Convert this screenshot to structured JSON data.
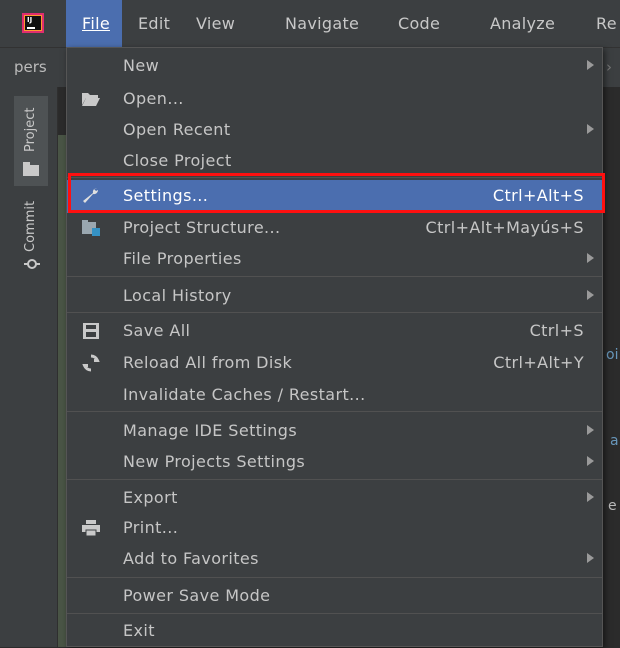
{
  "menubar": {
    "items": [
      {
        "label": "File"
      },
      {
        "label": "Edit"
      },
      {
        "label": "View"
      },
      {
        "label": "Navigate"
      },
      {
        "label": "Code"
      },
      {
        "label": "Analyze"
      },
      {
        "label": "Re"
      }
    ]
  },
  "breadcrumb": {
    "text": "pers"
  },
  "tool_window": {
    "project_label": "Project",
    "commit_label": "Commit"
  },
  "file_menu": {
    "items": [
      {
        "label": "New",
        "shortcut": "",
        "submenu": true
      },
      {
        "label": "Open...",
        "shortcut": "",
        "submenu": false
      },
      {
        "label": "Open Recent",
        "shortcut": "",
        "submenu": true
      },
      {
        "label": "Close Project",
        "shortcut": "",
        "submenu": false
      },
      {
        "label": "Settings...",
        "shortcut": "Ctrl+Alt+S",
        "submenu": false
      },
      {
        "label": "Project Structure...",
        "shortcut": "Ctrl+Alt+Mayús+S",
        "submenu": false
      },
      {
        "label": "File Properties",
        "shortcut": "",
        "submenu": true
      },
      {
        "label": "Local History",
        "shortcut": "",
        "submenu": true
      },
      {
        "label": "Save All",
        "shortcut": "Ctrl+S",
        "submenu": false
      },
      {
        "label": "Reload All from Disk",
        "shortcut": "Ctrl+Alt+Y",
        "submenu": false
      },
      {
        "label": "Invalidate Caches / Restart...",
        "shortcut": "",
        "submenu": false
      },
      {
        "label": "Manage IDE Settings",
        "shortcut": "",
        "submenu": true
      },
      {
        "label": "New Projects Settings",
        "shortcut": "",
        "submenu": true
      },
      {
        "label": "Export",
        "shortcut": "",
        "submenu": true
      },
      {
        "label": "Print...",
        "shortcut": "",
        "submenu": false
      },
      {
        "label": "Add to Favorites",
        "shortcut": "",
        "submenu": true
      },
      {
        "label": "Power Save Mode",
        "shortcut": "",
        "submenu": false
      },
      {
        "label": "Exit",
        "shortcut": "",
        "submenu": false
      }
    ],
    "selected_item": "Settings..."
  },
  "editor_peek": [
    "oi",
    "a",
    "e"
  ],
  "colors": {
    "menu_bg": "#3c3f41",
    "selection": "#4b6eaf",
    "highlight_box": "#ff1010"
  }
}
